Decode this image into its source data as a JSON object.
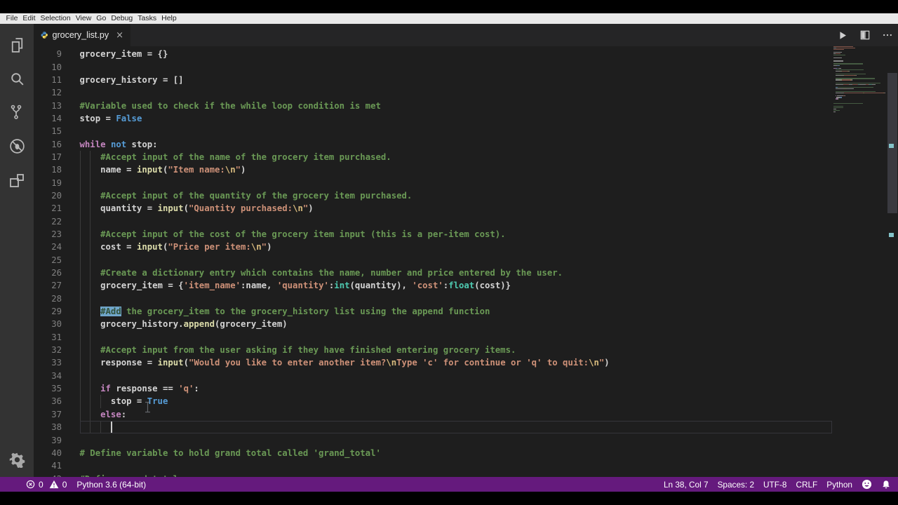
{
  "menu": {
    "items": [
      "File",
      "Edit",
      "Selection",
      "View",
      "Go",
      "Debug",
      "Tasks",
      "Help"
    ]
  },
  "tab": {
    "title": "grocery_list.py",
    "close_glyph": "×"
  },
  "editor_actions": {
    "run": "run",
    "split": "split-editor",
    "more": "more-actions"
  },
  "activity_icons": [
    "explorer",
    "search",
    "source-control",
    "debug",
    "extensions",
    "settings-gear"
  ],
  "editor": {
    "first_line": 9,
    "cursor": {
      "line": 38,
      "col": 7
    },
    "lines": [
      {
        "n": 9,
        "tokens": [
          [
            "pl",
            "grocery_item = {}"
          ]
        ]
      },
      {
        "n": 10,
        "tokens": []
      },
      {
        "n": 11,
        "tokens": [
          [
            "pl",
            "grocery_history = []"
          ]
        ]
      },
      {
        "n": 12,
        "tokens": []
      },
      {
        "n": 13,
        "tokens": [
          [
            "cm",
            "#Variable used to check if the while loop condition is met"
          ]
        ]
      },
      {
        "n": 14,
        "tokens": [
          [
            "pl",
            "stop = "
          ],
          [
            "kb",
            "False"
          ]
        ]
      },
      {
        "n": 15,
        "tokens": []
      },
      {
        "n": 16,
        "tokens": [
          [
            "kw",
            "while"
          ],
          [
            "pl",
            " "
          ],
          [
            "kb",
            "not"
          ],
          [
            "pl",
            " stop:"
          ]
        ]
      },
      {
        "n": 17,
        "tokens": [
          [
            "pl",
            "    "
          ],
          [
            "cm",
            "#Accept input of the name of the grocery item purchased."
          ]
        ]
      },
      {
        "n": 18,
        "tokens": [
          [
            "pl",
            "    name = "
          ],
          [
            "fn",
            "input"
          ],
          [
            "pl",
            "("
          ],
          [
            "st",
            "\"Item name:"
          ],
          [
            "esc",
            "\\n"
          ],
          [
            "st",
            "\""
          ],
          [
            "pl",
            ")"
          ]
        ]
      },
      {
        "n": 19,
        "tokens": []
      },
      {
        "n": 20,
        "tokens": [
          [
            "pl",
            "    "
          ],
          [
            "cm",
            "#Accept input of the quantity of the grocery item purchased."
          ]
        ]
      },
      {
        "n": 21,
        "tokens": [
          [
            "pl",
            "    quantity = "
          ],
          [
            "fn",
            "input"
          ],
          [
            "pl",
            "("
          ],
          [
            "st",
            "\"Quantity purchased:"
          ],
          [
            "esc",
            "\\n"
          ],
          [
            "st",
            "\""
          ],
          [
            "pl",
            ")"
          ]
        ]
      },
      {
        "n": 22,
        "tokens": []
      },
      {
        "n": 23,
        "tokens": [
          [
            "pl",
            "    "
          ],
          [
            "cm",
            "#Accept input of the cost of the grocery item input (this is a per-item cost)."
          ]
        ]
      },
      {
        "n": 24,
        "tokens": [
          [
            "pl",
            "    cost = "
          ],
          [
            "fn",
            "input"
          ],
          [
            "pl",
            "("
          ],
          [
            "st",
            "\"Price per item:"
          ],
          [
            "esc",
            "\\n"
          ],
          [
            "st",
            "\""
          ],
          [
            "pl",
            ")"
          ]
        ]
      },
      {
        "n": 25,
        "tokens": []
      },
      {
        "n": 26,
        "tokens": [
          [
            "pl",
            "    "
          ],
          [
            "cm",
            "#Create a dictionary entry which contains the name, number and price entered by the user."
          ]
        ]
      },
      {
        "n": 27,
        "tokens": [
          [
            "pl",
            "    grocery_item = {"
          ],
          [
            "st",
            "'item_name'"
          ],
          [
            "pl",
            ":name, "
          ],
          [
            "st",
            "'quantity'"
          ],
          [
            "pl",
            ":"
          ],
          [
            "ty",
            "int"
          ],
          [
            "pl",
            "(quantity), "
          ],
          [
            "st",
            "'cost'"
          ],
          [
            "pl",
            ":"
          ],
          [
            "ty",
            "float"
          ],
          [
            "pl",
            "(cost)}"
          ]
        ]
      },
      {
        "n": 28,
        "tokens": []
      },
      {
        "n": 29,
        "tokens": [
          [
            "pl",
            "    "
          ],
          [
            "selcm",
            "#Add"
          ],
          [
            "cm",
            " the grocery_item to the grocery_history list using the append function"
          ]
        ]
      },
      {
        "n": 30,
        "tokens": [
          [
            "pl",
            "    grocery_history."
          ],
          [
            "fn",
            "append"
          ],
          [
            "pl",
            "(grocery_item)"
          ]
        ]
      },
      {
        "n": 31,
        "tokens": []
      },
      {
        "n": 32,
        "tokens": [
          [
            "pl",
            "    "
          ],
          [
            "cm",
            "#Accept input from the user asking if they have finished entering grocery items."
          ]
        ]
      },
      {
        "n": 33,
        "tokens": [
          [
            "pl",
            "    response = "
          ],
          [
            "fn",
            "input"
          ],
          [
            "pl",
            "("
          ],
          [
            "st",
            "\"Would you like to enter another item?"
          ],
          [
            "esc",
            "\\n"
          ],
          [
            "st",
            "Type 'c' for continue or 'q' to quit:"
          ],
          [
            "esc",
            "\\n"
          ],
          [
            "st",
            "\""
          ],
          [
            "pl",
            ")"
          ]
        ]
      },
      {
        "n": 34,
        "tokens": []
      },
      {
        "n": 35,
        "tokens": [
          [
            "pl",
            "    "
          ],
          [
            "kw",
            "if"
          ],
          [
            "pl",
            " response == "
          ],
          [
            "st",
            "'q'"
          ],
          [
            "pl",
            ":"
          ]
        ]
      },
      {
        "n": 36,
        "tokens": [
          [
            "pl",
            "      stop = "
          ],
          [
            "kb",
            "True"
          ]
        ]
      },
      {
        "n": 37,
        "tokens": [
          [
            "pl",
            "    "
          ],
          [
            "kw",
            "else"
          ],
          [
            "pl",
            ":"
          ]
        ]
      },
      {
        "n": 38,
        "tokens": []
      },
      {
        "n": 39,
        "tokens": []
      },
      {
        "n": 40,
        "tokens": [
          [
            "cm",
            "# Define variable to hold grand total called 'grand_total'"
          ]
        ]
      },
      {
        "n": 41,
        "tokens": []
      },
      {
        "n": 42,
        "tokens": [
          [
            "cm",
            "#Define grand_total"
          ]
        ]
      }
    ]
  },
  "minimap": {
    "above": [
      [
        [
          "st",
          39
        ]
      ],
      [
        [
          "pl",
          5
        ],
        [
          "st",
          38
        ]
      ],
      [
        [
          "st",
          21
        ]
      ],
      [],
      [
        [
          "pl",
          17
        ]
      ],
      [
        [
          "pl",
          4
        ],
        [
          "st",
          10
        ]
      ],
      [
        [
          "cm",
          24
        ]
      ],
      []
    ],
    "below": [
      [
        [
          "cm",
          19
        ]
      ],
      [
        [
          "pl",
          6
        ]
      ],
      [
        [
          "cm",
          13
        ]
      ],
      [
        [
          "pl",
          4
        ]
      ]
    ]
  },
  "status_bar": {
    "errors": "0",
    "warnings": "0",
    "interpreter": "Python 3.6 (64-bit)",
    "line_col": "Ln 38, Col 7",
    "indent": "Spaces: 2",
    "encoding": "UTF-8",
    "eol": "CRLF",
    "language": "Python"
  },
  "colors": {
    "statusbar": "#651a7d",
    "editor_bg": "#1e1e1e",
    "activitybar_bg": "#333333",
    "tabbar_bg": "#252526",
    "menubar_bg": "#e9e9e9",
    "selection_highlight": "#70a6ca"
  }
}
